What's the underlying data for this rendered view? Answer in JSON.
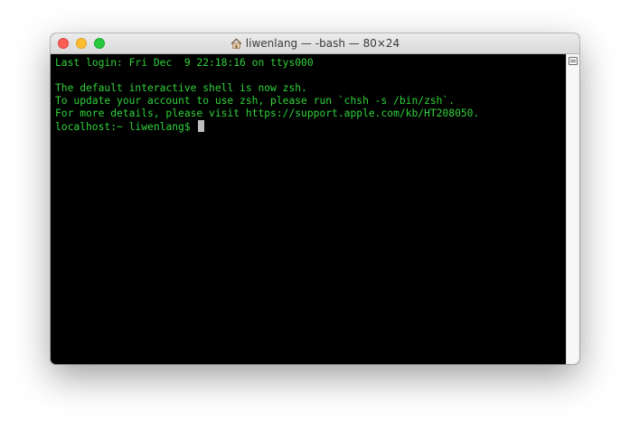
{
  "window": {
    "title": "liwenlang — -bash — 80×24",
    "colors": {
      "close": "#fd5f57",
      "minimize": "#febc2e",
      "zoom": "#28c840",
      "terminal_bg": "#000000",
      "terminal_text": "#30d33a"
    },
    "title_icon": "home-icon"
  },
  "terminal": {
    "lines": [
      "Last login: Fri Dec  9 22:18:16 on ttys000",
      "",
      "The default interactive shell is now zsh.",
      "To update your account to use zsh, please run `chsh -s /bin/zsh`.",
      "For more details, please visit https://support.apple.com/kb/HT208050."
    ],
    "prompt": "localhost:~ liwenlang$ "
  }
}
